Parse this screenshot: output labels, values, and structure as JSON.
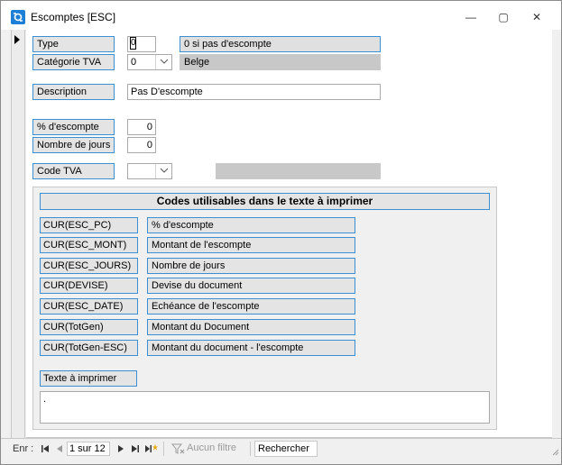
{
  "window": {
    "title": "Escomptes [ESC]",
    "minimize_glyph": "—",
    "restore_glyph": "▢",
    "close_glyph": "✕"
  },
  "form": {
    "type_label": "Type",
    "type_value": "0",
    "type_hint": "0 si pas d'escompte",
    "categorie_label": "Catégorie TVA",
    "categorie_value": "0",
    "categorie_name": "Belge",
    "description_label": "Description",
    "description_value": "Pas D'escompte",
    "pct_label": "% d'escompte",
    "pct_value": "0",
    "jours_label": "Nombre de jours",
    "jours_value": "0",
    "code_tva_label": "Code TVA",
    "code_tva_value": "",
    "code_tva_name": ""
  },
  "codes": {
    "header": "Codes utilisables dans le texte à imprimer",
    "rows": [
      {
        "code": "CUR(ESC_PC)",
        "desc": "% d'escompte"
      },
      {
        "code": "CUR(ESC_MONT)",
        "desc": "Montant de l'escompte"
      },
      {
        "code": "CUR(ESC_JOURS)",
        "desc": "Nombre de jours"
      },
      {
        "code": "CUR(DEVISE)",
        "desc": "Devise du document"
      },
      {
        "code": "CUR(ESC_DATE)",
        "desc": "Echéance de l'escompte"
      },
      {
        "code": "CUR(TotGen)",
        "desc": "Montant du Document"
      },
      {
        "code": "CUR(TotGen-ESC)",
        "desc": "Montant du document - l'escompte"
      }
    ],
    "texte_label": "Texte à imprimer",
    "texte_value": "."
  },
  "navigation": {
    "record_label": "Enr :",
    "record_position": "1 sur 12",
    "filter_label": "Aucun filtre",
    "search_label": "Rechercher"
  },
  "colors": {
    "label_border": "#3b8fd4",
    "label_bg": "#e4e4e4",
    "app_icon": "#1e7fd6"
  }
}
